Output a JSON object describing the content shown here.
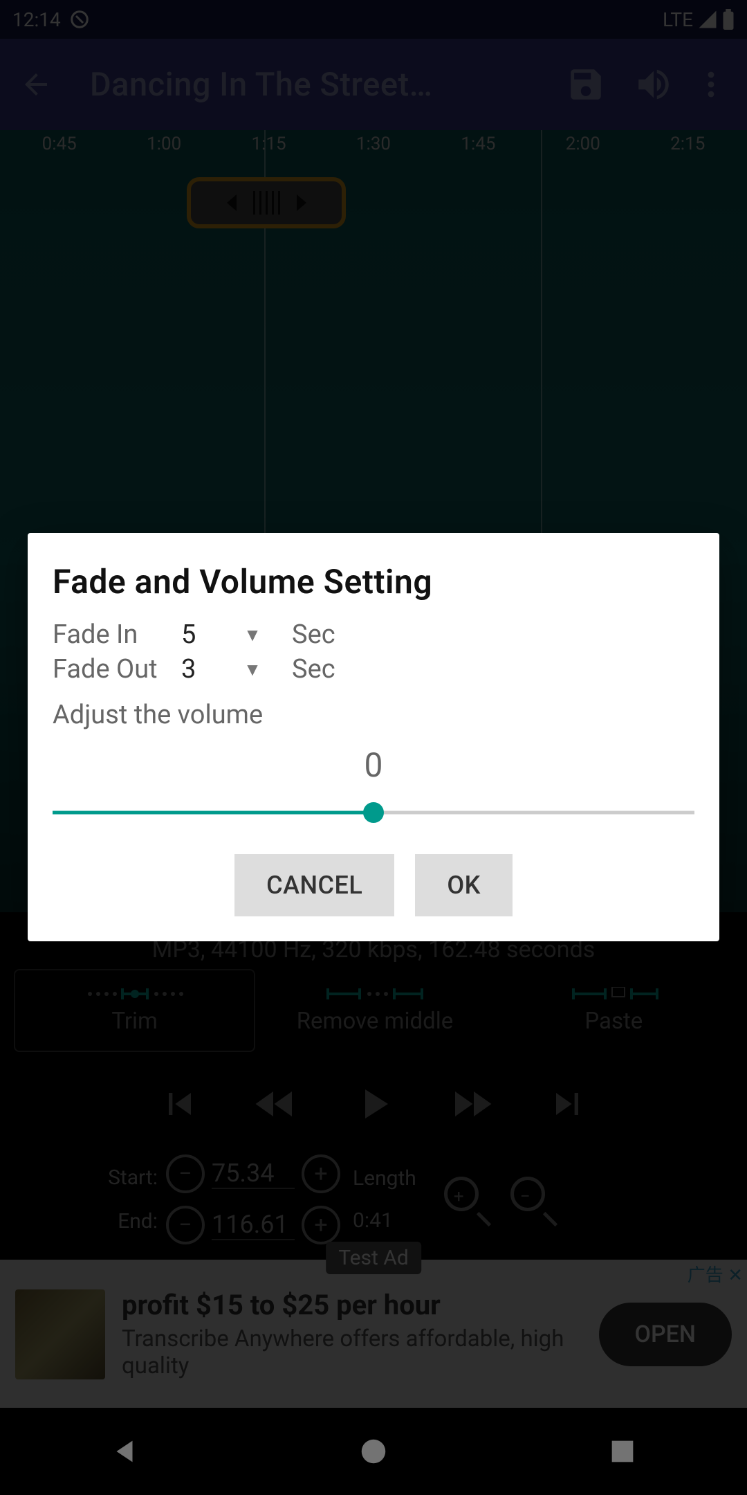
{
  "statusbar": {
    "time": "12:14",
    "network": "LTE"
  },
  "appbar": {
    "title": "Dancing In The Street…"
  },
  "timeline": [
    "0:45",
    "1:00",
    "1:15",
    "1:30",
    "1:45",
    "2:00",
    "2:15"
  ],
  "dialog": {
    "title": "Fade and Volume Setting",
    "fade_in_label": "Fade In",
    "fade_in_value": "5",
    "fade_out_label": "Fade Out",
    "fade_out_value": "3",
    "unit": "Sec",
    "adjust_label": "Adjust the volume",
    "volume_value": "0",
    "cancel": "CANCEL",
    "ok": "OK"
  },
  "file_info": "MP3, 44100 Hz, 320 kbps, 162.48 seconds",
  "modes": {
    "trim": "Trim",
    "remove": "Remove middle",
    "paste": "Paste"
  },
  "range": {
    "start_label": "Start:",
    "end_label": "End:",
    "start_value": "75.34",
    "end_value": "116.61",
    "length_label": "Length",
    "length_value": "0:41"
  },
  "ad": {
    "badge": "Test Ad",
    "corner": "广告",
    "close": "✕",
    "title": "profit $15 to $25 per hour",
    "subtitle": "Transcribe Anywhere offers affordable, high quality",
    "button": "OPEN"
  },
  "colors": {
    "accent": "#009a8c",
    "appbar": "#3b3f8f"
  }
}
